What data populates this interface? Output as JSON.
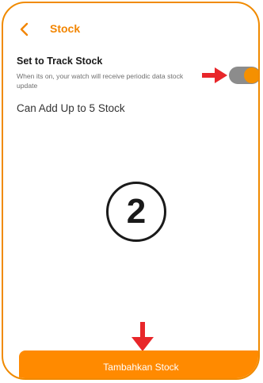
{
  "header": {
    "title": "Stock",
    "back_icon": "chevron-left-icon"
  },
  "track_stock": {
    "title": "Set to Track Stock",
    "description": "When its on, your watch will receive periodic data stock update",
    "toggle_on": true
  },
  "limit_text": "Can Add Up to 5 Stock",
  "step_label": "2",
  "add_button": {
    "label": "Tambahkan Stock"
  },
  "colors": {
    "accent": "#FF8A00",
    "frame": "#F08A00",
    "annotation_arrow": "#E8262A"
  }
}
